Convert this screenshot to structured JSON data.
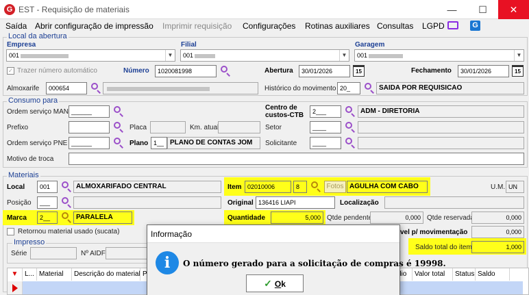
{
  "window": {
    "title": "EST - Requisição de materiais",
    "logo": "G"
  },
  "menu": {
    "items": [
      "Saída",
      "Abrir configuração de impressão",
      "Imprimir requisição",
      "Configurações",
      "Rotinas auxiliares",
      "Consultas",
      "LGPD"
    ],
    "disabled_index": 2,
    "icons": [
      "monitor-icon",
      "app-logo-icon"
    ]
  },
  "local_abertura": {
    "title": "Local da abertura",
    "empresa_label": "Empresa",
    "empresa_value": "001",
    "filial_label": "Filial",
    "filial_value": "001",
    "garagem_label": "Garagem",
    "garagem_value": "001",
    "trazer_label": "Trazer número automático",
    "numero_label": "Número",
    "numero_value": "1020081998",
    "abertura_label": "Abertura",
    "abertura_value": "30/01/2026",
    "fechamento_label": "Fechamento",
    "fechamento_value": "30/01/2026",
    "calendar_glyph": "15",
    "almoxarife_label": "Almoxarife",
    "almoxarife_value": "000654",
    "historico_label": "Histórico do movimento",
    "historico_code": "20_",
    "historico_desc": "SAIDA POR REQUISICAO"
  },
  "consumo": {
    "title": "Consumo para",
    "os_man_label": "Ordem serviço MAN",
    "os_man_value": "______",
    "centro_label_1": "Centro de",
    "centro_label_2": "custos-CTB",
    "centro_code": "2___",
    "centro_desc": "ADM - DIRETORIA",
    "prefixo_label": "Prefixo",
    "placa_label": "Placa",
    "km_label": "Km. atual",
    "setor_label": "Setor",
    "setor_value": "____",
    "os_pne_label": "Ordem serviço PNE",
    "os_pne_value": "______",
    "plano_label": "Plano",
    "plano_code": "1__",
    "plano_desc": "PLANO DE CONTAS JOM",
    "solicitante_label": "Solicitante",
    "solicitante_value": "____",
    "motivo_label": "Motivo de troca"
  },
  "materiais": {
    "title": "Materiais",
    "local_label": "Local",
    "local_code": "001",
    "local_desc": "ALMOXARIFADO CENTRAL",
    "item_label": "Item",
    "item_code": "02010006",
    "item_digit": "8",
    "fotos_label": "Fotos",
    "item_desc": "AGULHA COM CABO",
    "um_label": "U.M.",
    "um_value": "UN",
    "posicao_label": "Posição",
    "posicao_value": "___",
    "original_label": "Original",
    "original_value": "136416 LIAPI",
    "localizacao_label": "Localização",
    "marca_label": "Marca",
    "marca_code": "2__",
    "marca_desc": "PARALELA",
    "quantidade_label": "Quantidade",
    "quantidade_value": "5,000",
    "qtde_pendente_label": "Qtde pendente",
    "qtde_pendente_value": "0,000",
    "qtde_reservada_label": "Qtde reservada",
    "qtde_reservada_value": "0,000",
    "retornou_label": "Retornou material usado (sucata)",
    "disponivel_label": "vel p/ movimentação",
    "disponivel_value": "0,000",
    "saldo_label": "Saldo total do item",
    "saldo_value": "1,000"
  },
  "impresso": {
    "title": "Impresso",
    "serie_label": "Série",
    "aidf_label": "Nº AIDF"
  },
  "grid": {
    "columns": [
      "L...",
      "Material",
      "Descrição do material",
      "P",
      "dio",
      "Valor total",
      "Status",
      "Saldo"
    ]
  },
  "dialog": {
    "title": "Informação",
    "message": "O número gerado para a solicitação de compras é 19998.",
    "icon_glyph": "i",
    "ok_label": "Ok",
    "ok_underline_letter": "O",
    "ok_rest": "k",
    "check_glyph": "✓"
  },
  "colors": {
    "highlight": "#ffff1a",
    "accent_blue": "#1c3f94",
    "icon_purple": "#9b4fc9"
  }
}
